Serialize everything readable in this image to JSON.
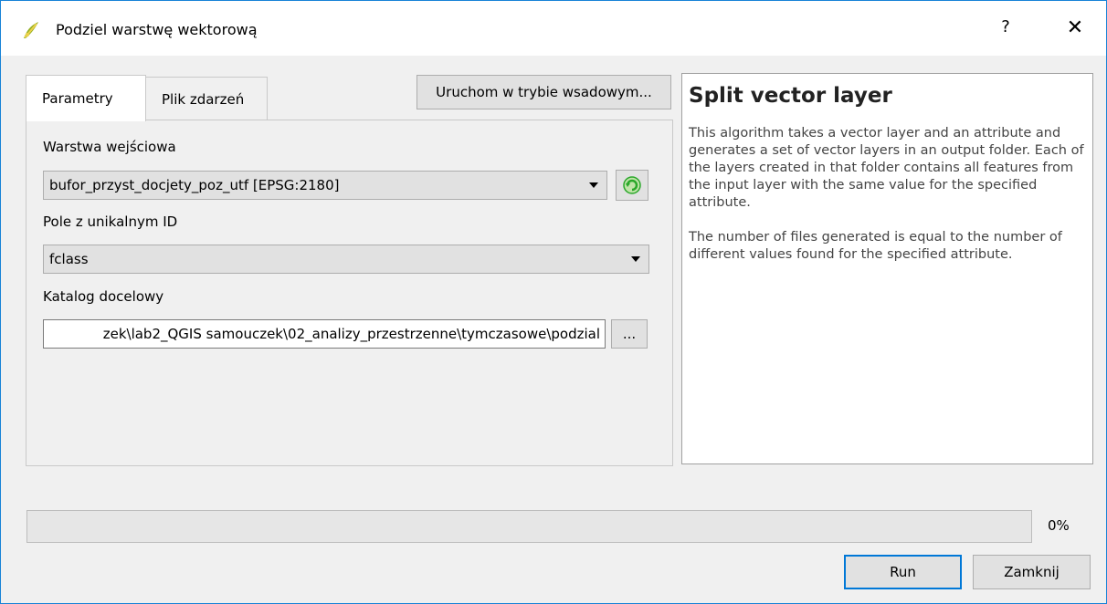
{
  "window": {
    "title": "Podziel warstwę wektorową",
    "help_glyph": "?",
    "close_glyph": "✕"
  },
  "tabs": [
    {
      "label": "Parametry"
    },
    {
      "label": "Plik zdarzeń"
    }
  ],
  "batch_button": {
    "label": "Uruchom w trybie wsadowym..."
  },
  "params": {
    "input_layer": {
      "label": "Warstwa wejściowa",
      "value": "bufor_przyst_docjety_poz_utf [EPSG:2180]"
    },
    "unique_field": {
      "label": "Pole z unikalnym ID",
      "value": "fclass"
    },
    "output_dir": {
      "label": "Katalog docelowy",
      "value": "zek\\lab2_QGIS samouczek\\02_analizy_przestrzenne\\tymczasowe\\podzial",
      "browse_label": "..."
    }
  },
  "help": {
    "title": "Split vector layer",
    "paragraph1": "This algorithm takes a vector layer and an attribute and generates a set of vector layers in an output folder. Each of the layers created in that folder contains all features from the input layer with the same value for the specified attribute.",
    "paragraph2": "The number of files generated is equal to the number of different values found for the specified attribute."
  },
  "progress": {
    "value": 0,
    "label": "0%"
  },
  "buttons": {
    "run": "Run",
    "close": "Zamknij"
  },
  "colors": {
    "accent": "#0078d7",
    "progress_fill": "#06b025",
    "refresh_icon": "#2aa82a"
  },
  "icons": {
    "app": "qgis-icon",
    "refresh": "refresh-icon",
    "dropdown": "chevron-down-icon"
  }
}
